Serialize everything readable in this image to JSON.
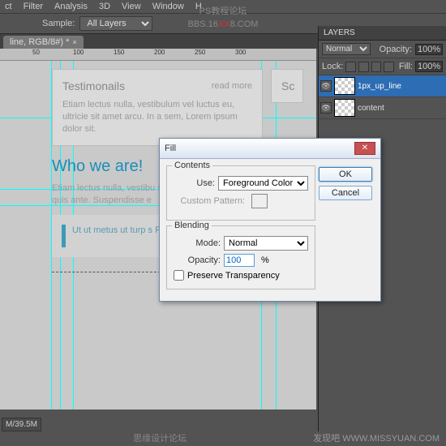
{
  "menu": {
    "items": [
      "ct",
      "Filter",
      "Analysis",
      "3D",
      "View",
      "Window",
      "H"
    ]
  },
  "toolbar": {
    "sample_label": "Sample:",
    "sample_value": "All Layers"
  },
  "tab": {
    "name": "line, RGB/8#) *",
    "close": "×"
  },
  "ruler": {
    "marks": [
      "50",
      "100",
      "150",
      "200",
      "250",
      "300"
    ]
  },
  "doc": {
    "testimonials": {
      "title": "Testimonails",
      "readmore": "read more",
      "para": "Etiam lectus nulla, vestibulum vel luctus eu, ultricie sit amet arcu. In a sem, Lorem ipsum dolor sit."
    },
    "who": {
      "title": "Who we are!",
      "para": "Etiam lectus nulla, vestibu sem a nibh fringilla blandit quis ante. Suspendisse e",
      "quote": "Ut ut metus ut turp s Fusce cursus egesta"
    },
    "side": {
      "title": "Sc"
    }
  },
  "layers_panel": {
    "title": "LAYERS",
    "blend": "Normal",
    "opacity_lbl": "Opacity:",
    "opacity": "100%",
    "lock_lbl": "Lock:",
    "fill_lbl": "Fill:",
    "fill": "100%",
    "items": [
      {
        "name": "1px_up_line"
      },
      {
        "name": "content"
      }
    ]
  },
  "dialog": {
    "title": "Fill",
    "contents": {
      "legend": "Contents",
      "use_lbl": "Use:",
      "use_val": "Foreground Color",
      "pattern_lbl": "Custom Pattern:"
    },
    "blending": {
      "legend": "Blending",
      "mode_lbl": "Mode:",
      "mode_val": "Normal",
      "opacity_lbl": "Opacity:",
      "opacity_val": "100",
      "pct": "%",
      "preserve": "Preserve Transparency"
    },
    "ok": "OK",
    "cancel": "Cancel"
  },
  "watermark": {
    "l1": "PS教程论坛",
    "l2a": "BBS.16",
    "l2b": "XX",
    "l2c": "8.COM"
  },
  "status": "M/39.5M",
  "footer": {
    "mid": "思缘设计论坛",
    "right_a": "发现吧",
    "right_b": "WWW.MISSYUAN.COM"
  }
}
